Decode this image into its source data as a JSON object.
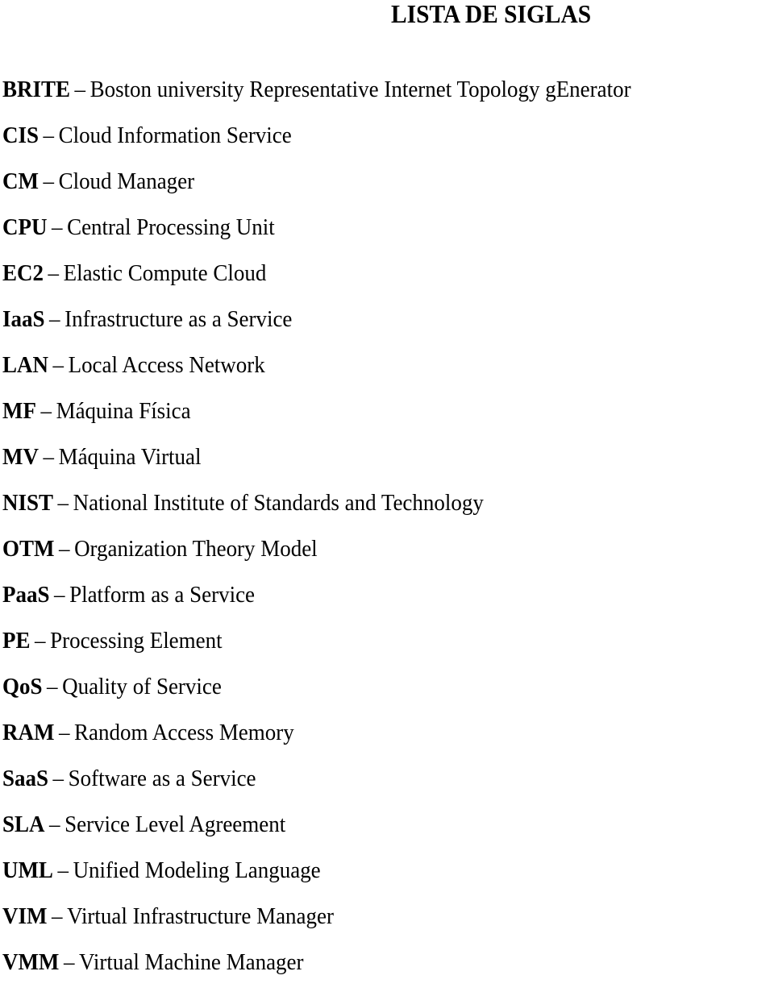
{
  "title": "LISTA DE SIGLAS",
  "separator": "–",
  "entries": [
    {
      "abbr": "BRITE",
      "def": "Boston university Representative Internet Topology gEnerator"
    },
    {
      "abbr": "CIS",
      "def": "Cloud Information Service"
    },
    {
      "abbr": "CM",
      "def": "Cloud Manager"
    },
    {
      "abbr": "CPU",
      "def": "Central Processing Unit"
    },
    {
      "abbr": "EC2",
      "def": "Elastic Compute Cloud"
    },
    {
      "abbr": "IaaS",
      "def": "Infrastructure as a Service"
    },
    {
      "abbr": "LAN",
      "def": "Local Access Network"
    },
    {
      "abbr": "MF",
      "def": "Máquina Física"
    },
    {
      "abbr": "MV",
      "def": "Máquina Virtual"
    },
    {
      "abbr": "NIST",
      "def": "National Institute of Standards and Technology"
    },
    {
      "abbr": "OTM",
      "def": "Organization Theory Model"
    },
    {
      "abbr": "PaaS",
      "def": "Platform as a Service"
    },
    {
      "abbr": "PE",
      "def": "Processing Element"
    },
    {
      "abbr": "QoS",
      "def": "Quality of Service"
    },
    {
      "abbr": "RAM",
      "def": "Random Access Memory"
    },
    {
      "abbr": "SaaS",
      "def": "Software as a Service"
    },
    {
      "abbr": "SLA",
      "def": "Service Level Agreement"
    },
    {
      "abbr": "UML",
      "def": "Unified Modeling Language"
    },
    {
      "abbr": "VIM",
      "def": "Virtual Infrastructure Manager"
    },
    {
      "abbr": "VMM",
      "def": "Virtual Machine Manager"
    }
  ]
}
